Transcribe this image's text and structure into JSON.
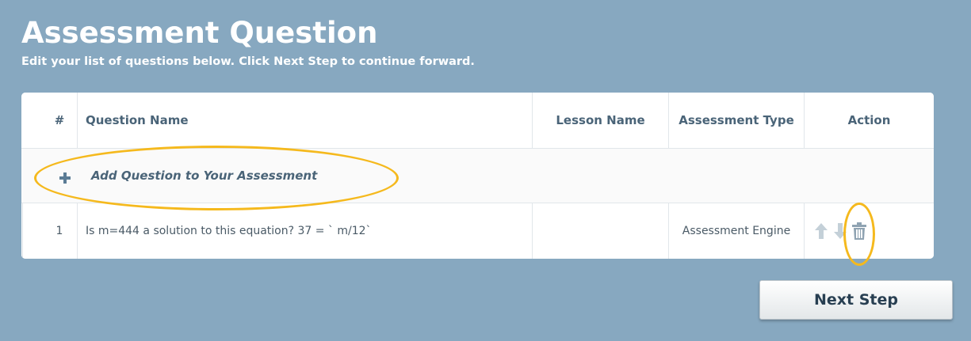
{
  "header": {
    "title": "Assessment Question",
    "subtitle": "Edit your list of questions below. Click Next Step to continue forward."
  },
  "table": {
    "columns": [
      "#",
      "Question Name",
      "Lesson Name",
      "Assessment Type",
      "Action"
    ],
    "add_label": "Add Question to Your Assessment",
    "rows": [
      {
        "number": "1",
        "question": "Is m=444 a solution to this equation? 37 = ` m/12`",
        "lesson": "",
        "type": "Assessment Engine"
      }
    ]
  },
  "icons": {
    "add": "plus-icon",
    "move_up": "arrow-up-icon",
    "move_down": "arrow-down-icon",
    "delete": "trash-icon"
  },
  "footer": {
    "next_label": "Next Step"
  },
  "colors": {
    "background": "#87a8c0",
    "highlight": "#f5b91d",
    "header_text": "#4a6478"
  }
}
